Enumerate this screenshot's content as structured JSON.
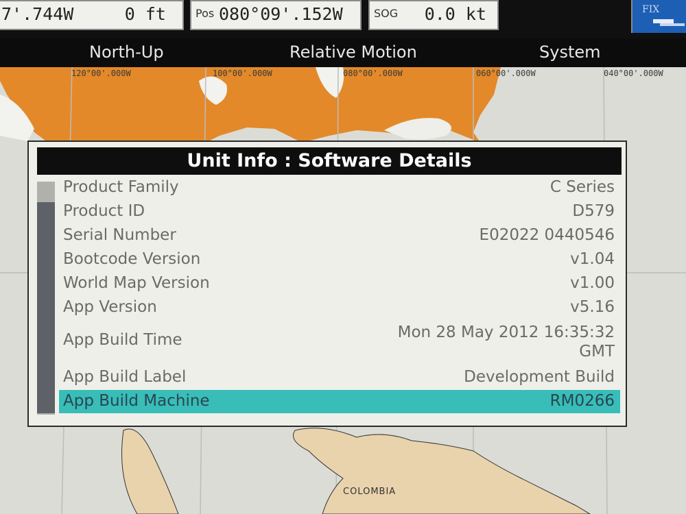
{
  "topbar": {
    "box1": {
      "value_a": "7'.744W",
      "value_b": "0 ft"
    },
    "box2": {
      "label": "Pos",
      "value": "080°09'.152W"
    },
    "box3": {
      "label": "SOG",
      "value": "0.0 kt"
    },
    "fix": {
      "label": "FIX"
    }
  },
  "menu": {
    "north_up": "North-Up",
    "relative_motion": "Relative Motion",
    "system": "System"
  },
  "chart": {
    "lon_labels": [
      "120°00'.000W",
      "100°00'.000W",
      "080°00'.000W",
      "060°00'.000W",
      "040°00'.000W"
    ],
    "place_label": "COLOMBIA"
  },
  "dialog": {
    "title": "Unit Info : Software Details",
    "rows": [
      {
        "label": "Product Family",
        "value": "C Series"
      },
      {
        "label": "Product ID",
        "value": "D579"
      },
      {
        "label": "Serial Number",
        "value": "E02022 0440546"
      },
      {
        "label": "Bootcode Version",
        "value": "v1.04"
      },
      {
        "label": "World Map Version",
        "value": "v1.00"
      },
      {
        "label": "App Version",
        "value": "v5.16"
      },
      {
        "label": "App Build Time",
        "value_line1": "Mon 28 May 2012  16:35:32",
        "value_line2": "GMT"
      },
      {
        "label": "App Build Label",
        "value": "Development Build"
      },
      {
        "label": "App Build Machine",
        "value": "RM0266"
      }
    ],
    "selected_index": 8
  },
  "colors": {
    "land_orange": "#e3892a",
    "land_tan": "#e9d3ad",
    "sea": "#dcdcd6",
    "highlight": "#38bdb8",
    "title_bar": "#0e0e0e"
  }
}
